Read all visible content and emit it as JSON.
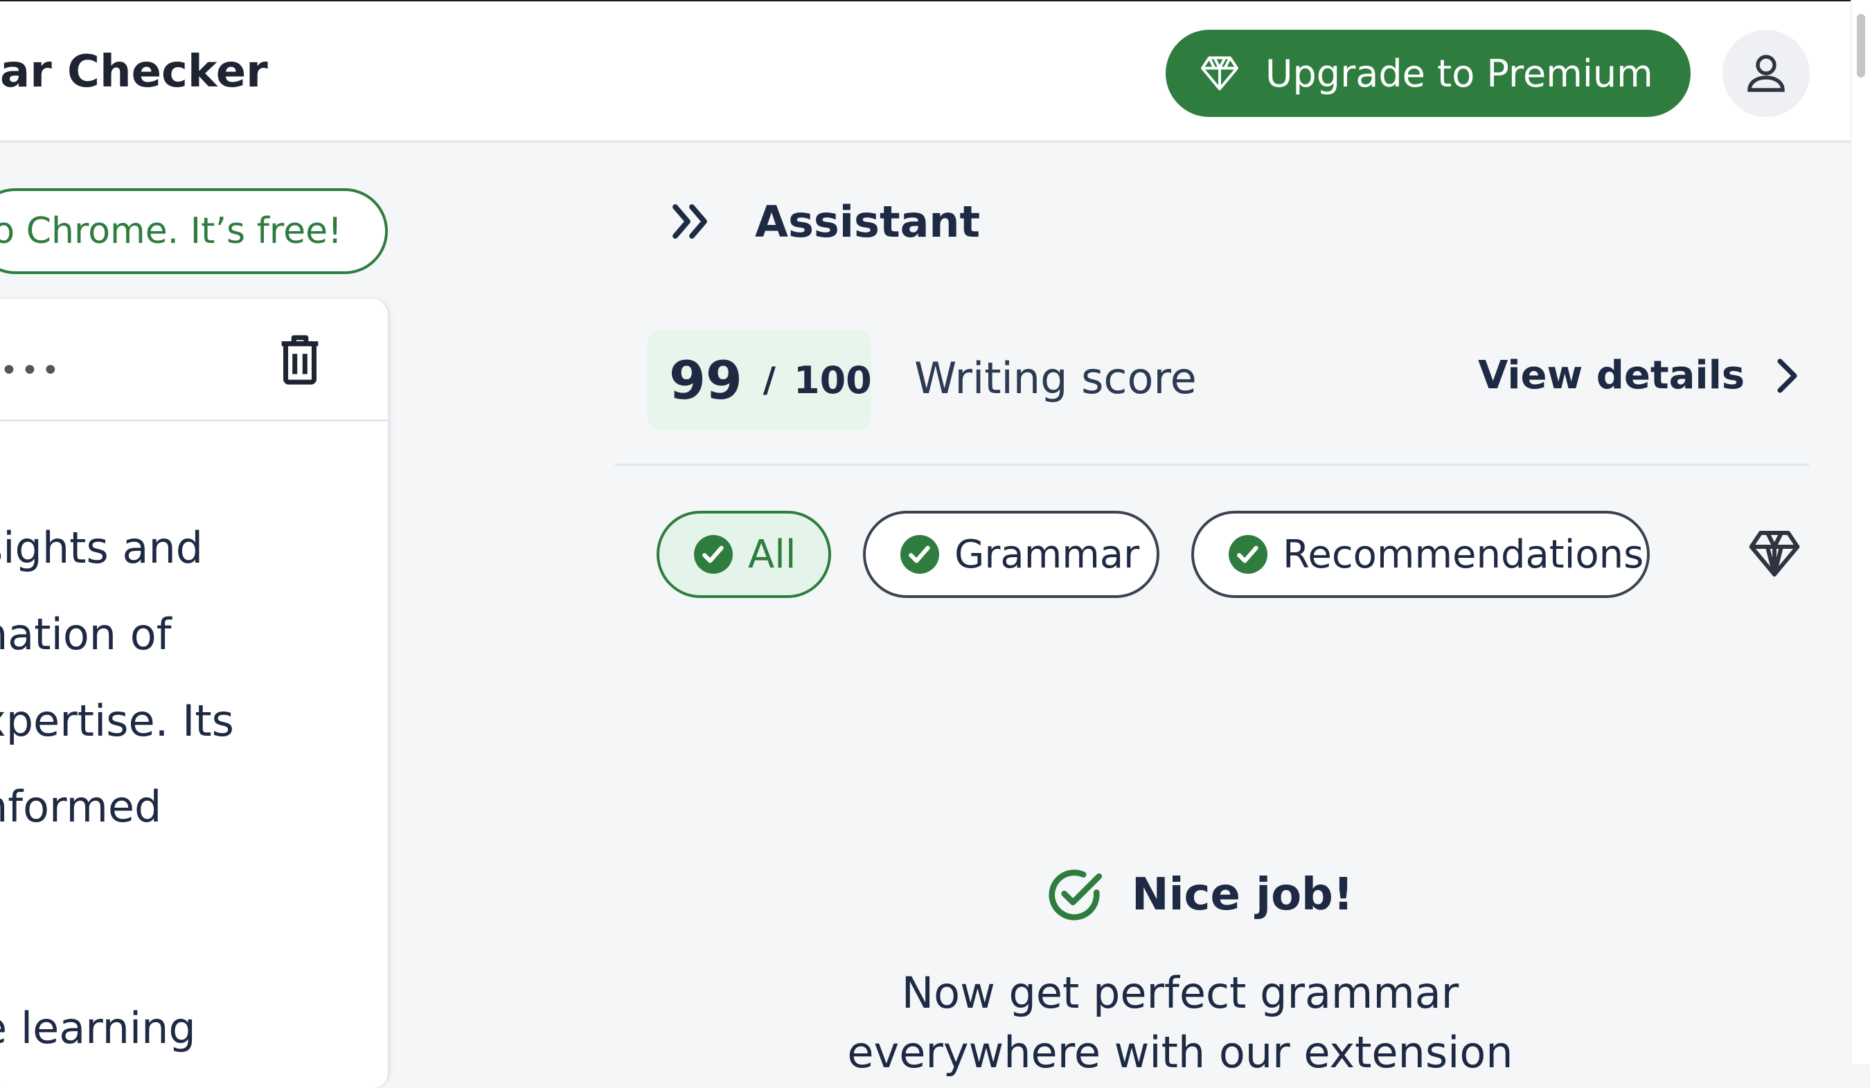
{
  "header": {
    "app_title": "ar Checker",
    "upgrade_label": "Upgrade to Premium",
    "upgrade_icon": "diamond-icon",
    "profile_icon": "user-icon"
  },
  "sidebar": {
    "chrome_button_label": "o Chrome. It’s free!",
    "more_label": "•••",
    "delete_icon": "trash-icon",
    "text_lines": [
      "sights and",
      "nation of",
      "xpertise. Its",
      "nformed",
      "",
      "e learning"
    ]
  },
  "assistant": {
    "title": "Assistant",
    "score": {
      "value": "99",
      "separator": "/",
      "max": "100",
      "label": "Writing score"
    },
    "view_details_label": "View details",
    "filters": [
      {
        "label": "All",
        "active": true
      },
      {
        "label": "Grammar",
        "active": false
      },
      {
        "label": "Recommendations",
        "active": false
      }
    ],
    "nice_job_label": "Nice job!",
    "promo_line_1": "Now get perfect grammar",
    "promo_line_2": "everywhere with our extension"
  },
  "colors": {
    "brand_green": "#2e7d3f",
    "text_dark": "#1e2a44",
    "score_bg": "#e8f5ec",
    "background": "#f4f6f8"
  }
}
